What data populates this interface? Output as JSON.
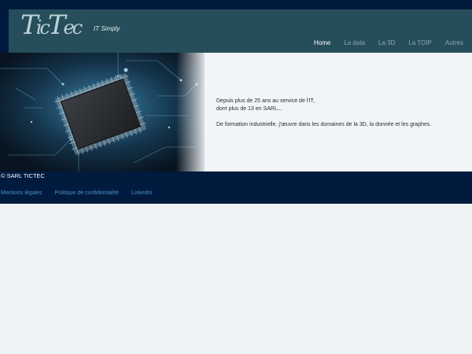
{
  "header": {
    "logo_text_1": "T",
    "logo_text_2": "ic",
    "logo_text_3": "T",
    "logo_text_4": "ec",
    "tagline": "IT Simply"
  },
  "nav": {
    "items": [
      "Home",
      "La data",
      "La 3D",
      "La TOIP",
      "Autres"
    ],
    "active": "Home"
  },
  "hero": {
    "line1": "Depuis plus de 25 ans au service de l'IT,",
    "line2": "dont plus de 13 en SARL...",
    "line3": "De formation industrielle, j'œuvre dans les domaines de la 3D, la donnée et les graphes."
  },
  "footer": {
    "copyright": "© SARL TICTEC",
    "links": [
      "Mentions légales",
      "Politique de confidentialité",
      "LinkedIn"
    ]
  },
  "colors": {
    "page_bg": "#011b3f",
    "header_bg": "#254e5a",
    "link": "#4b8fc9"
  }
}
